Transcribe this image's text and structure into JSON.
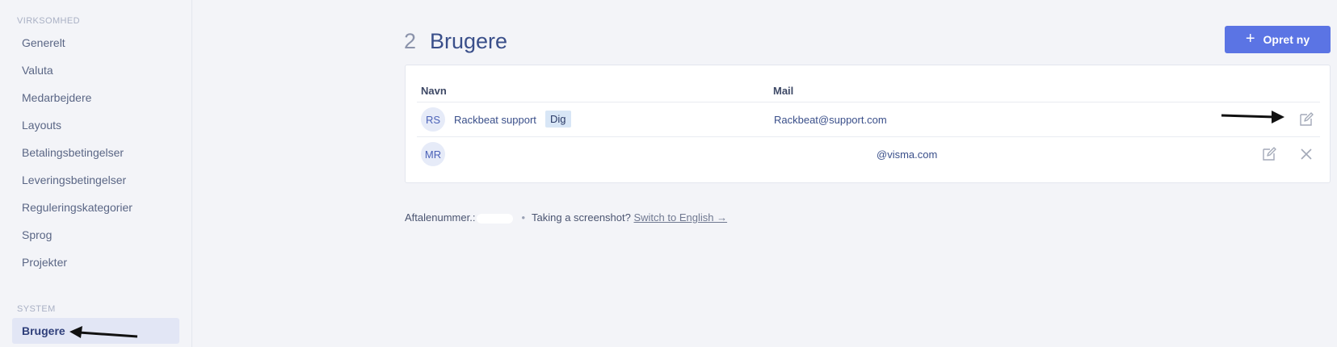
{
  "sidebar": {
    "section_company": "VIRKSOMHED",
    "items": [
      {
        "label": "Generelt"
      },
      {
        "label": "Valuta"
      },
      {
        "label": "Medarbejdere"
      },
      {
        "label": "Layouts"
      },
      {
        "label": "Betalingsbetingelser"
      },
      {
        "label": "Leveringsbetingelser"
      },
      {
        "label": "Reguleringskategorier"
      },
      {
        "label": "Sprog"
      },
      {
        "label": "Projekter"
      }
    ],
    "section_system": "SYSTEM",
    "system_items": [
      {
        "label": "Brugere",
        "active": true
      }
    ]
  },
  "header": {
    "count": "2",
    "title": "Brugere",
    "create_label": "Opret ny"
  },
  "table": {
    "columns": {
      "name": "Navn",
      "mail": "Mail"
    },
    "rows": [
      {
        "initials": "RS",
        "name": "Rackbeat support",
        "badge": "Dig",
        "mail": "Rackbeat@support.com"
      },
      {
        "initials": "MR",
        "name": "",
        "badge": "",
        "mail": "@visma.com"
      }
    ]
  },
  "footer": {
    "agreement_label": "Aftalenummer.:",
    "separator": "•",
    "screenshot_text": "Taking a screenshot?",
    "switch_link": "Switch to English →"
  },
  "colors": {
    "accent": "#5b74e4",
    "active_nav_bg": "#e2e6f5",
    "badge_bg": "#d8e6f6",
    "title": "#3a4f8a"
  },
  "icons": [
    "plus-icon",
    "edit-icon",
    "close-icon",
    "annotation-arrow"
  ]
}
